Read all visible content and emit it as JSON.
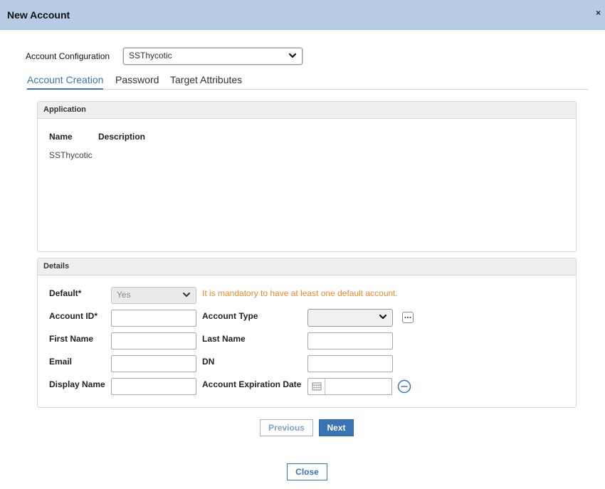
{
  "dialog": {
    "title": "New Account",
    "close_glyph": "×"
  },
  "account_configuration": {
    "label": "Account Configuration",
    "value": "SSThycotic"
  },
  "tabs": [
    {
      "label": "Account Creation",
      "active": true
    },
    {
      "label": "Password",
      "active": false
    },
    {
      "label": "Target Attributes",
      "active": false
    }
  ],
  "application_panel": {
    "heading": "Application",
    "columns": [
      "Name",
      "Description"
    ],
    "rows": [
      {
        "name": "SSThycotic",
        "description": ""
      }
    ]
  },
  "details_panel": {
    "heading": "Details",
    "default": {
      "label": "Default*",
      "value": "Yes",
      "warning": "It is mandatory to have at least one default account."
    },
    "account_id": {
      "label": "Account ID*",
      "value": ""
    },
    "account_type": {
      "label": "Account Type",
      "value": "",
      "more_icon": "ellipsis-icon"
    },
    "first_name": {
      "label": "First Name",
      "value": ""
    },
    "last_name": {
      "label": "Last Name",
      "value": ""
    },
    "email": {
      "label": "Email",
      "value": ""
    },
    "dn": {
      "label": "DN",
      "value": ""
    },
    "display_name": {
      "label": "Display Name",
      "value": ""
    },
    "expiration": {
      "label": "Account Expiration Date",
      "value": "",
      "icon": "calendar-icon",
      "clear_icon": "minus-circle-icon"
    }
  },
  "buttons": {
    "previous": "Previous",
    "next": "Next",
    "close": "Close"
  },
  "colors": {
    "titlebar": "#b7cce4",
    "accent": "#3a74b6",
    "warning": "#f0882b"
  }
}
